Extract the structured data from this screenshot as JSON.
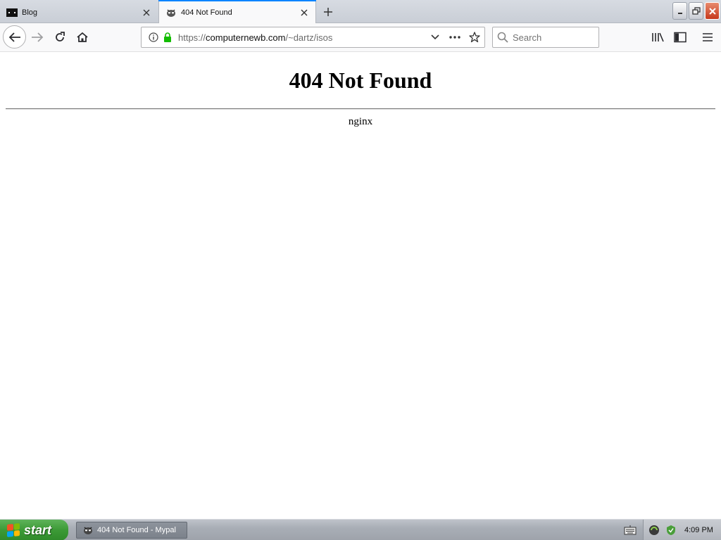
{
  "tabs": [
    {
      "title": "Blog",
      "active": false
    },
    {
      "title": "404 Not Found",
      "active": true
    }
  ],
  "urlbar": {
    "protocol": "https://",
    "host": "computernewb.com",
    "path": "/~dartz/isos"
  },
  "search": {
    "placeholder": "Search"
  },
  "page": {
    "heading": "404 Not Found",
    "server": "nginx"
  },
  "taskbar": {
    "start_label": "start",
    "task_label": "404 Not Found - Mypal",
    "clock": "4:09 PM"
  },
  "colors": {
    "active_tab_accent": "#0a84ff",
    "secure_lock": "#12bc00",
    "start_green": "#3c9a36",
    "close_red": "#c6391c"
  }
}
